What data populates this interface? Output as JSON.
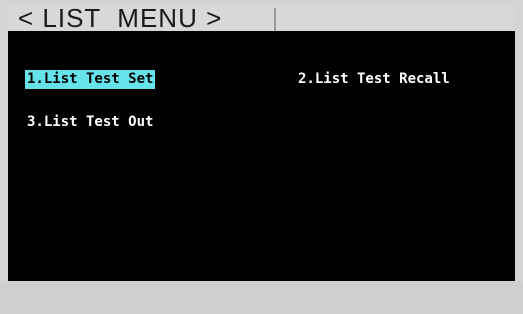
{
  "header": {
    "title": "< LIST  MENU >"
  },
  "menu": {
    "items": [
      {
        "label": "1.List Test Set",
        "selected": true
      },
      {
        "label": "2.List Test Recall",
        "selected": false
      },
      {
        "label": "3.List Test Out",
        "selected": false
      }
    ]
  },
  "colors": {
    "background": "#000000",
    "header_bar": "#d8d8d8",
    "selection_highlight": "#66e3ea",
    "text": "#ffffff"
  }
}
